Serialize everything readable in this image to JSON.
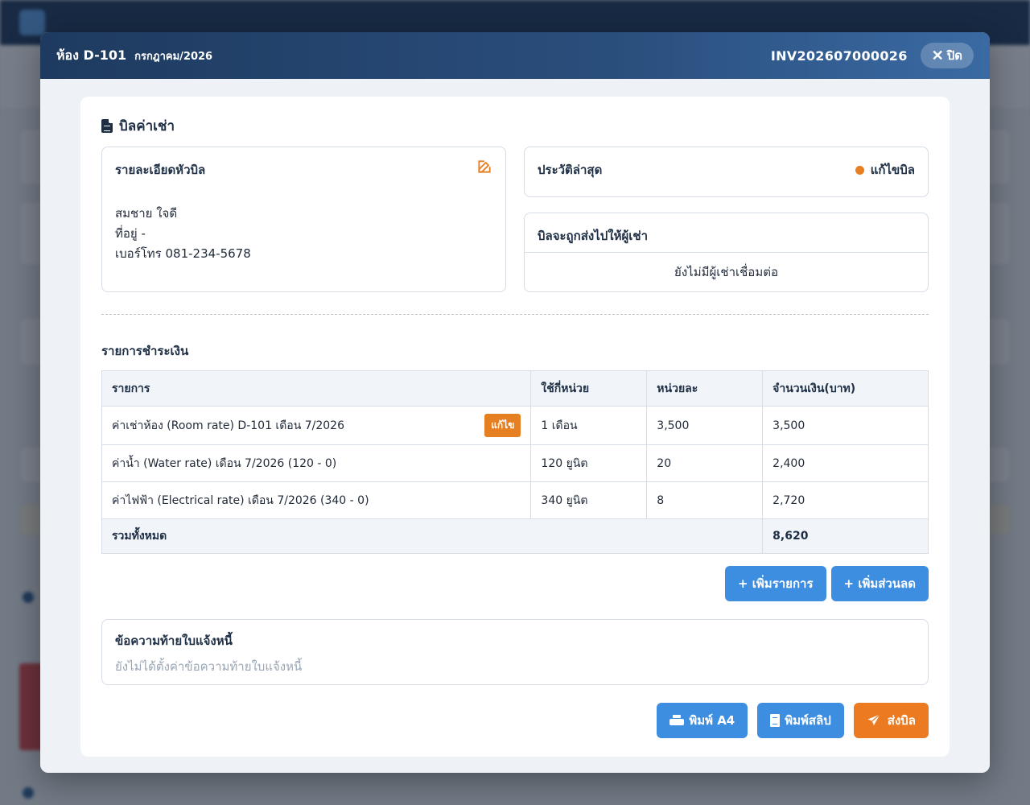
{
  "modal": {
    "room_title": "ห้อง D-101",
    "month": "กรกฎาคม/2026",
    "invoice_no": "INV202607000026",
    "close_label": "ปิด"
  },
  "bill": {
    "title": "บิลค่าเช่า",
    "details": {
      "heading": "รายละเอียดหัวบิล",
      "name": "สมชาย ใจดี",
      "address": "ที่อยู่ -",
      "phone": "เบอร์โทร 081-234-5678"
    },
    "history": {
      "heading": "ประวัติล่าสุด",
      "status": "แก้ไขบิล",
      "status_color": "#e67e22"
    },
    "send_to": {
      "heading": "บิลจะถูกส่งไปให้ผู้เช่า",
      "message": "ยังไม่มีผู้เช่าเชื่อมต่อ"
    }
  },
  "payments": {
    "title": "รายการชำระเงิน",
    "columns": [
      "รายการ",
      "ใช้กี่หน่วย",
      "หน่วยละ",
      "จำนวนเงิน(บาท)"
    ],
    "rows": [
      {
        "item": "ค่าเช่าห้อง (Room rate) D-101 เดือน 7/2026",
        "units": "1 เดือน",
        "rate": "3,500",
        "amount": "3,500",
        "edit_label": "แก้ไข"
      },
      {
        "item": "ค่าน้ำ (Water rate) เดือน 7/2026 (120 - 0)",
        "units": "120 ยูนิต",
        "rate": "20",
        "amount": "2,400"
      },
      {
        "item": "ค่าไฟฟ้า (Electrical rate) เดือน 7/2026 (340 - 0)",
        "units": "340 ยูนิต",
        "rate": "8",
        "amount": "2,720"
      }
    ],
    "total_label": "รวมทั้งหมด",
    "total_amount": "8,620",
    "add_item_label": "+ เพิ่มรายการ",
    "add_discount_label": "+ เพิ่มส่วนลด"
  },
  "footer_note": {
    "heading": "ข้อความท้ายใบแจ้งหนี้",
    "placeholder": "ยังไม่ได้ตั้งค่าข้อความท้ายใบแจ้งหนี้"
  },
  "actions": {
    "print_a4": "พิมพ์ A4",
    "print_slip": "พิมพ์สลิป",
    "send_bill": "ส่งบิล"
  },
  "colors": {
    "header_bg": "#1e3a5f",
    "primary": "#3d8de0",
    "accent": "#ec7a20"
  }
}
